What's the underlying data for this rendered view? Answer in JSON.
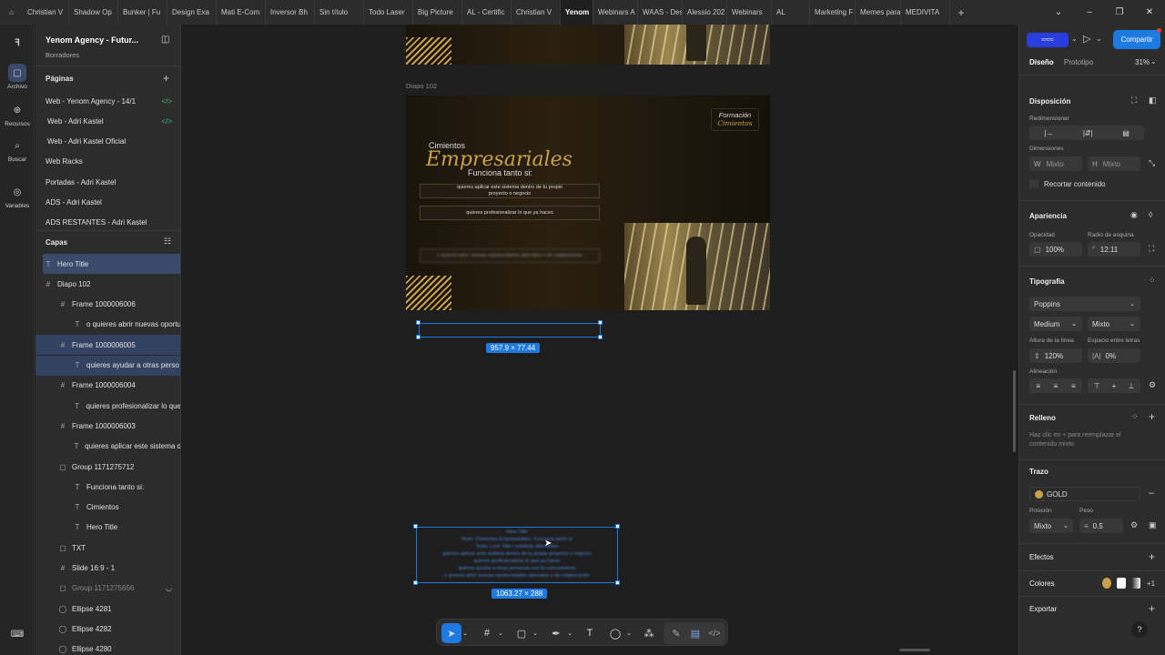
{
  "tabs": [
    "Christian V",
    "Shadow Op",
    "Bunker | Fu",
    "Design Exa",
    "Mati E-Com",
    "Inversor Bh",
    "Sin título",
    "Todo Laser",
    "Big Picture",
    "AL - Certific",
    "Christian V",
    "Yenom",
    "Webinars A",
    "WAAS - Des",
    "Alessio 202",
    "Webinars",
    "AL",
    "Marketing F",
    "Memes para",
    "MEDIVITA"
  ],
  "active_tab_index": 11,
  "rail": {
    "archivo": "Archivo",
    "recursos": "Recursos",
    "buscar": "Buscar",
    "variables": "Variables"
  },
  "file": {
    "name": "Yenom Agency - Futur...",
    "subtitle": "Borradores"
  },
  "pages": {
    "title": "Páginas",
    "items": [
      "Web - Yenom Agency - 14/1",
      "Web - Adri Kastel",
      "Web - Adri Kastel Oficial",
      "Web Racks",
      "Portadas - Adri Kastel",
      "ADS - Adri Kastel",
      "ADS RESTANTES - Adri Kastel"
    ]
  },
  "layers": {
    "title": "Capas",
    "items": [
      {
        "label": "Hero Title"
      },
      {
        "label": "Diapo 102"
      },
      {
        "label": "Frame 1000006006"
      },
      {
        "label": "o quieres abrir nuevas oportu"
      },
      {
        "label": "Frame 1000006005"
      },
      {
        "label": "quieres ayudar a otras perso"
      },
      {
        "label": "Frame 1000006004"
      },
      {
        "label": "quieres profesionalizar lo que"
      },
      {
        "label": "Frame 1000006003"
      },
      {
        "label": "quieres aplicar este sistema d"
      },
      {
        "label": "Group 1171275712"
      },
      {
        "label": "Funciona tanto si:"
      },
      {
        "label": "Cimientos"
      },
      {
        "label": "Hero Title"
      },
      {
        "label": "TXT"
      },
      {
        "label": "Slide 16:9 - 1"
      },
      {
        "label": "Group 1171275656"
      },
      {
        "label": "Ellipse 4281"
      },
      {
        "label": "Ellipse 4282"
      },
      {
        "label": "Ellipse 4280"
      }
    ]
  },
  "canvas": {
    "frame_label": "Diapo 102",
    "slide": {
      "badge_line1": "Formación",
      "badge_line2": "Cimientos",
      "small_title": "Cimientos",
      "big_title": "Empresariales",
      "funciona": "Funciona tanto si:",
      "box1": "quieres aplicar este sistema dentro de tu propio proyecto o negocio",
      "box2": "quieres profesionalizar lo que ya haces",
      "box3": "o quieres abrir nuevas oportunidades laborales o de colaboración"
    },
    "sel1_dims": "957.9 × 77.44",
    "sel2_dims": "1063.27 × 288",
    "sel2_text": "Hero Title\nTitulo: Cimientos Empresariales. Funciona tanto si:\nTexto: Lore Title / subtítulo alternativo\nquieres aplicar este sistema dentro de tu propio proyecto o negocio\nquieres profesionalizar lo que ya haces\nquieres ayudar a otras personas con tu conocimiento\no quieres abrir nuevas oportunidades laborales o de colaboración"
  },
  "right": {
    "share": "Compartir",
    "tab_design": "Diseño",
    "tab_proto": "Prototipo",
    "zoom": "31%",
    "disposicion": "Disposición",
    "redimensionar": "Redimensionar",
    "dimensiones": "Dimensiones",
    "w_label": "W",
    "w_val": "Mixto",
    "h_label": "H",
    "h_val": "Mixto",
    "recortar": "Recortar contenido",
    "apariencia": "Apariencia",
    "opacidad": "Opacidad",
    "opacidad_val": "100%",
    "radio": "Radio de esquina",
    "radio_val": "12.11",
    "tipografia": "Tipografía",
    "font": "Poppins",
    "weight": "Medium",
    "size": "Mixto",
    "altura": "Altura de la línea",
    "altura_val": "120%",
    "espacio": "Espacio entre letras",
    "espacio_val": "0%",
    "alineacion": "Alineación",
    "relleno": "Relleno",
    "relleno_hint": "Haz clic en + para reemplazar el contenido mixto",
    "trazo": "Trazo",
    "trazo_name": "GOLD",
    "posicion": "Posición",
    "posicion_val": "Mixto",
    "peso": "Peso",
    "peso_val": "0.5",
    "efectos": "Efectos",
    "colores": "Colores",
    "colores_more": "+1",
    "exportar": "Exportar",
    "help": "?"
  },
  "colors": {
    "accent": "#1d7ae0",
    "gold": "#c9a14a"
  }
}
